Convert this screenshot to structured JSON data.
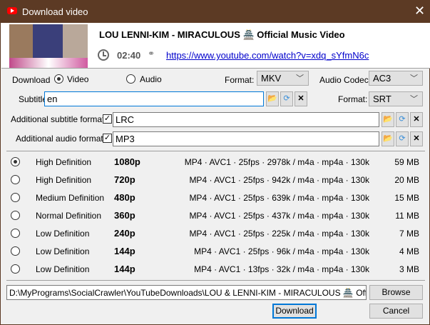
{
  "window": {
    "title": "Download video",
    "close_icon": "close-icon",
    "app_icon": "youtube-icon",
    "brand_color": "#5c3a24"
  },
  "video": {
    "title": "LOU  LENNI-KIM - MIRACULOUS 🏯  Official Music Video",
    "duration": "02:40",
    "url": "https://www.youtube.com/watch?v=xdq_sYfmN6c"
  },
  "options": {
    "download_label": "Download",
    "video_label": "Video",
    "audio_label": "Audio",
    "download_mode": "Video",
    "format_label": "Format:",
    "format_value": "MKV",
    "audio_codec_label": "Audio Codec",
    "audio_codec_value": "AC3",
    "subtitles_label": "Subtitles",
    "subtitles_value": "en",
    "sub_format_label": "Format:",
    "sub_format_value": "SRT",
    "add_sub_label": "Additional subtitle formats",
    "add_sub_checked": true,
    "add_sub_value": "LRC",
    "add_audio_label": "Additional audio formats",
    "add_audio_checked": true,
    "add_audio_value": "MP3"
  },
  "qualities": [
    {
      "label": "High Definition",
      "res": "1080p",
      "details": "MP4 · AVC1 · 25fps · 2978k / m4a · mp4a · 130k",
      "size": "59 MB",
      "selected": true
    },
    {
      "label": "High Definition",
      "res": "720p",
      "details": "MP4 · AVC1 · 25fps · 942k / m4a · mp4a · 130k",
      "size": "20 MB"
    },
    {
      "label": "Medium Definition",
      "res": "480p",
      "details": "MP4 · AVC1 · 25fps · 639k / m4a · mp4a · 130k",
      "size": "15 MB"
    },
    {
      "label": "Normal Definition",
      "res": "360p",
      "details": "MP4 · AVC1 · 25fps · 437k / m4a · mp4a · 130k",
      "size": "11 MB"
    },
    {
      "label": "Low Definition",
      "res": "240p",
      "details": "MP4 · AVC1 · 25fps · 225k / m4a · mp4a · 130k",
      "size": "7 MB"
    },
    {
      "label": "Low Definition",
      "res": "144p",
      "details": "MP4 · AVC1 · 25fps · 96k / m4a · mp4a · 130k",
      "size": "4 MB"
    },
    {
      "label": "Low Definition",
      "res": "144p",
      "details": "MP4 · AVC1 · 13fps · 32k / m4a · mp4a · 130k",
      "size": "3 MB"
    }
  ],
  "footer": {
    "path": "D:\\MyPrograms\\SocialCrawler\\YouTubeDownloads\\LOU & LENNI-KIM - MIRACULOUS 🏯  Official Music Video",
    "browse": "Browse",
    "download": "Download",
    "cancel": "Cancel"
  }
}
